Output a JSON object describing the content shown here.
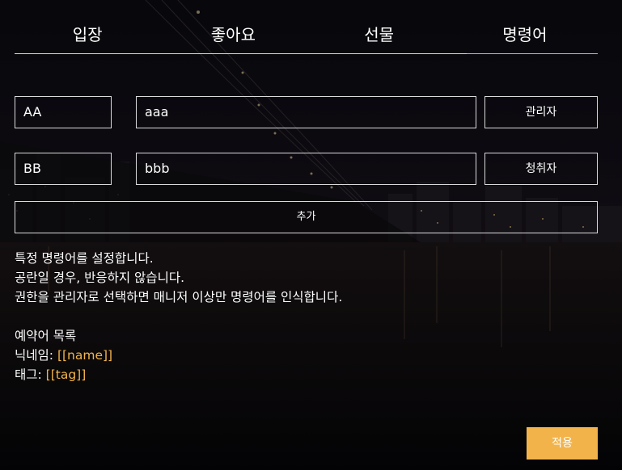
{
  "tabs": [
    {
      "label": "입장"
    },
    {
      "label": "좋아요"
    },
    {
      "label": "선물"
    },
    {
      "label": "명령어"
    }
  ],
  "commands": [
    {
      "key": "AA",
      "response": "aaa",
      "permission": "관리자"
    },
    {
      "key": "BB",
      "response": "bbb",
      "permission": "청취자"
    }
  ],
  "add_button": "추가",
  "info": {
    "line1": "특정 명령어를 설정합니다.",
    "line2": "공란일 경우, 반응하지 않습니다.",
    "line3": "권한을 관리자로 선택하면 매니저 이상만 명령어를 인식합니다.",
    "reserved_title": "예약어 목록",
    "nickname_label": "닉네임: ",
    "nickname_value": "[[name]]",
    "tag_label": "태그: ",
    "tag_value": "[[tag]]"
  },
  "apply_button": "적용",
  "colors": {
    "accent": "#f2b44a"
  }
}
